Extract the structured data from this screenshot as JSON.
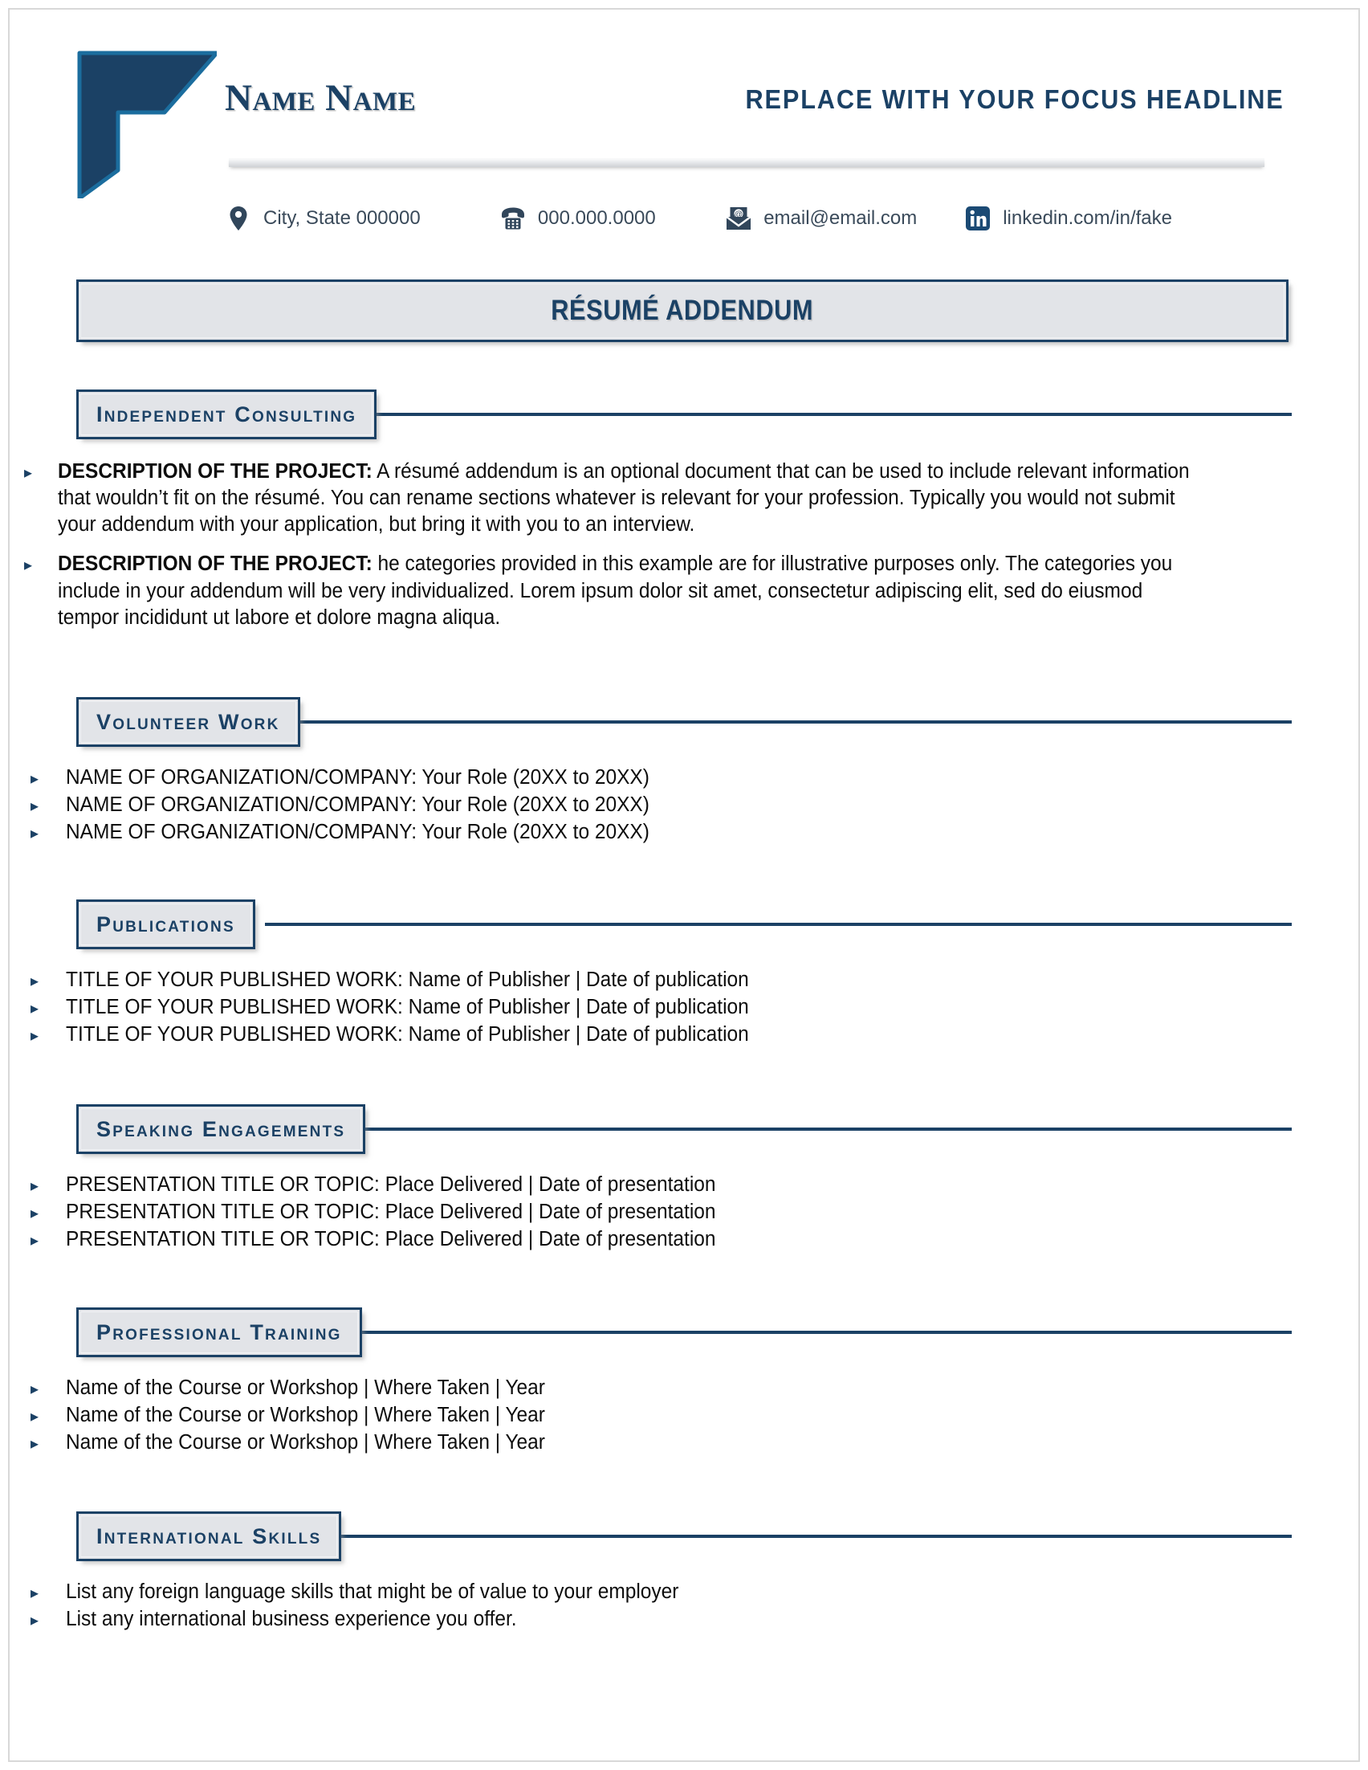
{
  "document": {
    "title": "RÉSUMÉ ADDENDUM",
    "accent_navy": "#1b4165",
    "accent_light_blue": "#1b6d9e",
    "band_gray": "#e2e4e8"
  },
  "header": {
    "name": "Name Name",
    "focus_headline": "REPLACE WITH YOUR FOCUS HEADLINE"
  },
  "contact": [
    {
      "icon": "location-pin-icon",
      "value": "City, State 000000"
    },
    {
      "icon": "telephone-icon",
      "value": "000.000.0000"
    },
    {
      "icon": "email-envelope-icon",
      "value": "email@email.com"
    },
    {
      "icon": "linkedin-icon",
      "value": "linkedin.com/in/fake"
    }
  ],
  "sections": [
    {
      "id": "independent-consulting",
      "heading": "Independent Consulting",
      "style": "paragraph",
      "items": [
        {
          "lead": "DESCRIPTION OF THE PROJECT:",
          "text": " A résumé addendum is an optional document that can be used to include relevant information that wouldn’t fit on the résumé. You can rename sections whatever is relevant for your profession. Typically you would not submit your addendum with your application, but bring it with you to an interview."
        },
        {
          "lead": "DESCRIPTION OF THE PROJECT:",
          "text": " he categories provided in this example are for illustrative purposes only. The categories you include in your addendum will be very individualized. Lorem ipsum dolor sit amet, consectetur adipiscing elit, sed do eiusmod tempor incididunt ut labore et dolore magna aliqua."
        }
      ]
    },
    {
      "id": "volunteer-work",
      "heading": "Volunteer Work",
      "style": "lines",
      "items": [
        {
          "text": "NAME OF ORGANIZATION/COMPANY: Your Role (20XX to 20XX)"
        },
        {
          "text": "NAME OF ORGANIZATION/COMPANY: Your Role (20XX to 20XX)"
        },
        {
          "text": "NAME OF ORGANIZATION/COMPANY: Your Role (20XX to 20XX)"
        }
      ]
    },
    {
      "id": "publications",
      "heading": "Publications",
      "style": "lines",
      "items": [
        {
          "text": "TITLE OF YOUR PUBLISHED WORK: Name of Publisher | Date of publication"
        },
        {
          "text": "TITLE OF YOUR PUBLISHED WORK: Name of Publisher | Date of publication"
        },
        {
          "text": "TITLE OF YOUR PUBLISHED WORK: Name of Publisher | Date of publication"
        }
      ]
    },
    {
      "id": "speaking-engagements",
      "heading": "Speaking Engagements",
      "style": "lines",
      "items": [
        {
          "text": "PRESENTATION TITLE OR TOPIC: Place Delivered | Date of presentation"
        },
        {
          "text": "PRESENTATION TITLE OR TOPIC: Place Delivered | Date of presentation"
        },
        {
          "text": "PRESENTATION TITLE OR TOPIC: Place Delivered | Date of presentation"
        }
      ]
    },
    {
      "id": "professional-training",
      "heading": "Professional Training",
      "style": "lines",
      "items": [
        {
          "text": "Name of the Course or Workshop | Where Taken | Year"
        },
        {
          "text": "Name of the Course or Workshop | Where Taken | Year"
        },
        {
          "text": "Name of the Course or Workshop | Where Taken | Year"
        }
      ]
    },
    {
      "id": "international-skills",
      "heading": "International Skills",
      "style": "lines",
      "items": [
        {
          "text": "List any foreign language skills that might be of value to your employer"
        },
        {
          "text": "List any international business experience you offer."
        }
      ]
    }
  ]
}
